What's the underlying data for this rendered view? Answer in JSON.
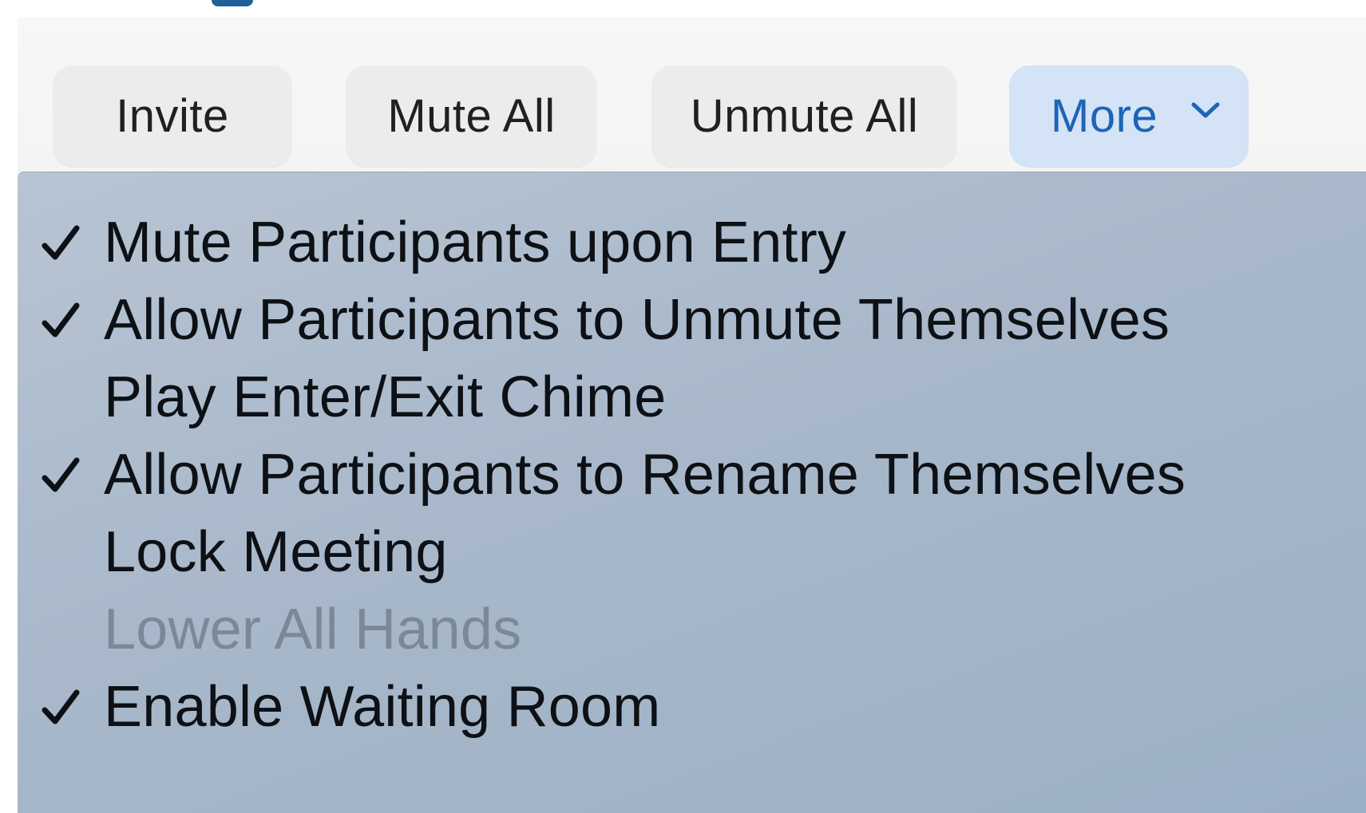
{
  "toolbar": {
    "buttons": [
      {
        "label": "Invite"
      },
      {
        "label": "Mute All"
      },
      {
        "label": "Unmute All"
      },
      {
        "label": "More",
        "icon": "chevron-down-icon"
      }
    ]
  },
  "menu": {
    "items": [
      {
        "label": "Mute Participants upon Entry",
        "checked": true,
        "enabled": true
      },
      {
        "label": "Allow Participants to Unmute Themselves",
        "checked": true,
        "enabled": true
      },
      {
        "label": "Play Enter/Exit Chime",
        "checked": false,
        "enabled": true
      },
      {
        "label": "Allow Participants to Rename Themselves",
        "checked": true,
        "enabled": true
      },
      {
        "label": "Lock Meeting",
        "checked": false,
        "enabled": true
      },
      {
        "label": "Lower All Hands",
        "checked": false,
        "enabled": false
      },
      {
        "label": "Enable Waiting Room",
        "checked": true,
        "enabled": true
      }
    ]
  },
  "colors": {
    "accent": "#1d65b8",
    "button_bg": "#ececed",
    "menu_bg": "#a8b8ca",
    "disabled_text": "#7b8896"
  }
}
